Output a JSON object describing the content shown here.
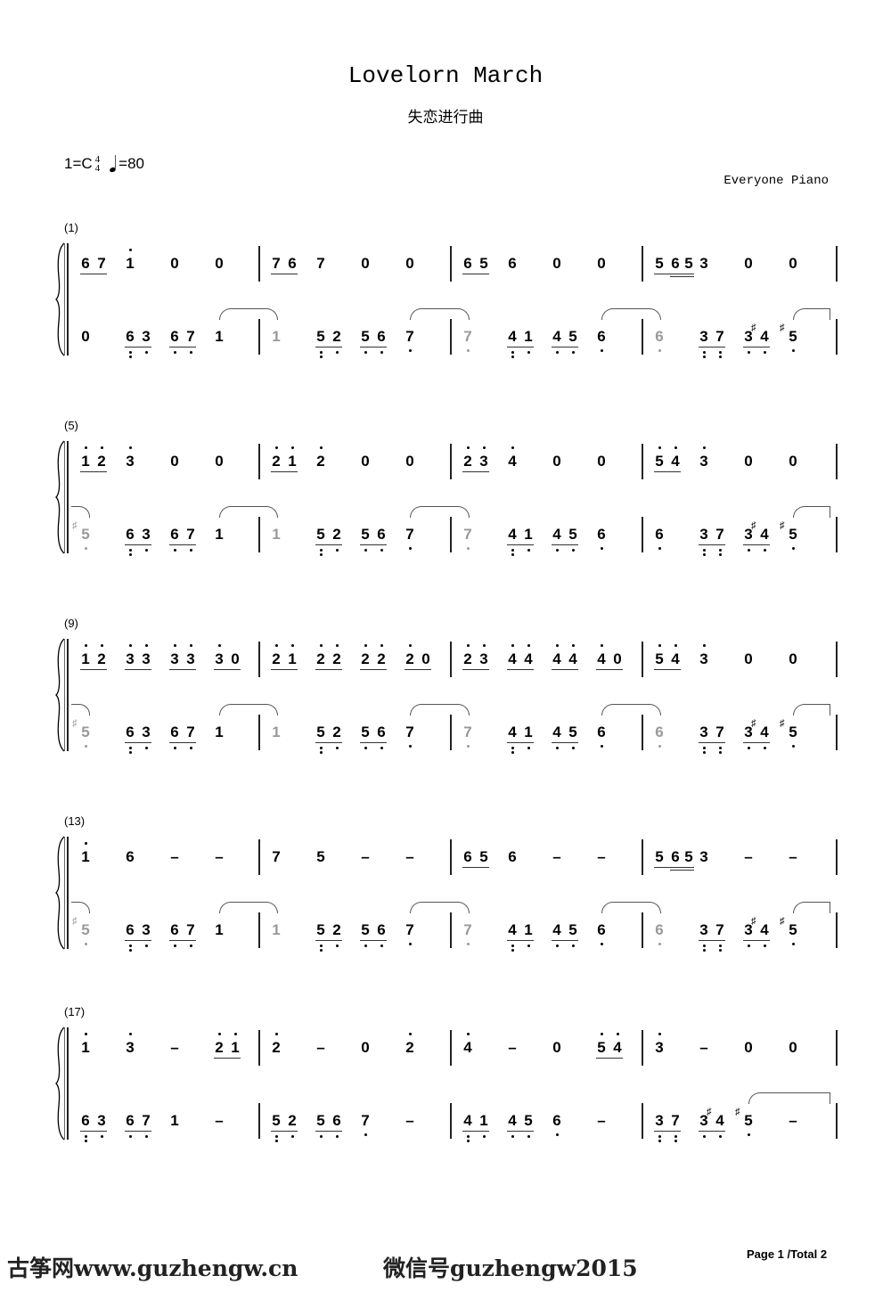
{
  "header": {
    "title": "Lovelorn March",
    "subtitle": "失恋进行曲",
    "key": "1=C",
    "time_top": "4",
    "time_bottom": "4",
    "tempo": "=80",
    "arranger": "Everyone Piano"
  },
  "notation_legend": "' = high octave dot, , = low octave dot, # = sharp, ~ = tied continuation (gray), ^ = tie start, = joins sixteenths",
  "rows": [
    {
      "label": "(1)",
      "upper": [
        [
          "6 7",
          "1'",
          "0",
          "0"
        ],
        [
          "7 6",
          "7",
          "0",
          "0"
        ],
        [
          "6 5",
          "6",
          "0",
          "0"
        ],
        [
          "5 6=5",
          "3",
          "0",
          "0"
        ]
      ],
      "lower": [
        [
          "0",
          "6,, 3,",
          "6, 7,",
          "1^"
        ],
        [
          "~1",
          "5,, 2,",
          "5, 6,",
          "7,^"
        ],
        [
          "~7,",
          "4,, 1,",
          "4, 5,",
          "6,^"
        ],
        [
          "~6,",
          "3,, 7,,",
          "3, #4,",
          "#5,^"
        ]
      ]
    },
    {
      "label": "(5)",
      "upper": [
        [
          "1' 2'",
          "3'",
          "0",
          "0"
        ],
        [
          "2' 1'",
          "2'",
          "0",
          "0"
        ],
        [
          "2' 3'",
          "4'",
          "0",
          "0"
        ],
        [
          "5' 4'",
          "3'",
          "0",
          "0"
        ]
      ],
      "lower": [
        [
          "~#5,",
          "6,, 3,",
          "6, 7,",
          "1^"
        ],
        [
          "~1",
          "5,, 2,",
          "5, 6,",
          "7,^"
        ],
        [
          "~7,",
          "4,, 1,",
          "4, 5,",
          "6,"
        ],
        [
          "6,",
          "3,, 7,,",
          "3, #4,",
          "#5,^"
        ]
      ]
    },
    {
      "label": "(9)",
      "upper": [
        [
          "1' 2'",
          "3' 3'",
          "3' 3'",
          "3' 0"
        ],
        [
          "2' 1'",
          "2' 2'",
          "2' 2'",
          "2' 0"
        ],
        [
          "2' 3'",
          "4' 4'",
          "4' 4'",
          "4' 0"
        ],
        [
          "5' 4'",
          "3'",
          "0",
          "0"
        ]
      ],
      "lower": [
        [
          "~#5,",
          "6,, 3,",
          "6, 7,",
          "1^"
        ],
        [
          "~1",
          "5,, 2,",
          "5, 6,",
          "7,^"
        ],
        [
          "~7,",
          "4,, 1,",
          "4, 5,",
          "6,^"
        ],
        [
          "~6,",
          "3,, 7,,",
          "3, #4,",
          "#5,^"
        ]
      ]
    },
    {
      "label": "(13)",
      "upper": [
        [
          "1'",
          "6",
          "–",
          "–"
        ],
        [
          "7",
          "5",
          "–",
          "–"
        ],
        [
          "6 5",
          "6",
          "–",
          "–"
        ],
        [
          "5 6=5",
          "3",
          "–",
          "–"
        ]
      ],
      "lower": [
        [
          "~#5,",
          "6,, 3,",
          "6, 7,",
          "1^"
        ],
        [
          "~1",
          "5,, 2,",
          "5, 6,",
          "7,^"
        ],
        [
          "~7,",
          "4,, 1,",
          "4, 5,",
          "6,^"
        ],
        [
          "~6,",
          "3,, 7,,",
          "3, #4,",
          "#5,^"
        ]
      ]
    },
    {
      "label": "(17)",
      "upper": [
        [
          "1'",
          "3'",
          "–",
          "2' 1'"
        ],
        [
          "2'",
          "–",
          "0",
          "2'"
        ],
        [
          "4'",
          "–",
          "0",
          "5' 4'"
        ],
        [
          "3'",
          "–",
          "0",
          "0"
        ]
      ],
      "lower": [
        [
          "6,, 3,",
          "6, 7,",
          "1",
          "–"
        ],
        [
          "5,, 2,",
          "5, 6,",
          "7,",
          "–"
        ],
        [
          "4,, 1,",
          "4, 5,",
          "6,",
          "–"
        ],
        [
          "3,, 7,,",
          "3, #4,",
          "#5,^",
          "–"
        ]
      ]
    }
  ],
  "footer": {
    "site": "古筝网www.guzhengw.cn",
    "wechat": "微信号guzhengw2015",
    "page": "Page 1 /Total 2"
  }
}
